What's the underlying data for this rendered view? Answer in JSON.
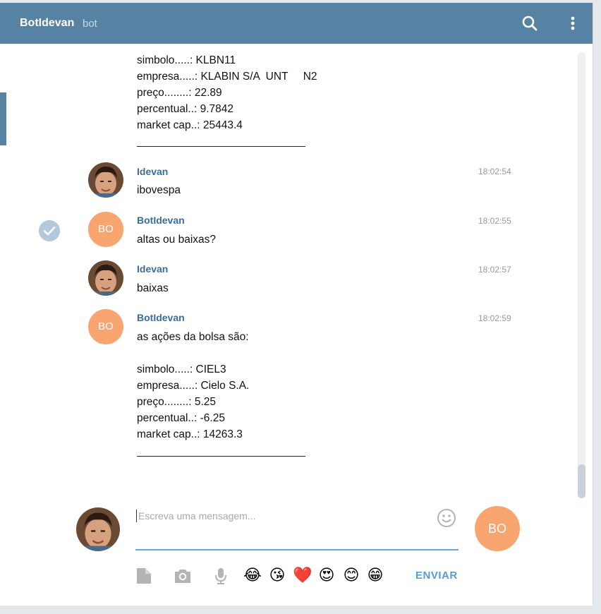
{
  "header": {
    "title": "BotIdevan",
    "subtitle": "bot",
    "search_icon": "search-icon",
    "menu_icon": "more-vert-icon",
    "bg_color": "#5682a3"
  },
  "messages": {
    "top_continuation": {
      "lines": [
        "simbolo.....: KLBN11",
        "empresa.....: KLABIN S/A  UNT     N2",
        "preço........: 22.89",
        "percentual..: 9.7842",
        "market cap..: 25443.4"
      ]
    },
    "m1": {
      "author": "Idevan",
      "time": "18:02:54",
      "text": "ibovespa"
    },
    "m2": {
      "author": "BotIdevan",
      "time": "18:02:55",
      "text": "altas ou baixas?",
      "avatar_initials": "BO",
      "status_icon": "check-circle-icon"
    },
    "m3": {
      "author": "Idevan",
      "time": "18:02:57",
      "text": "baixas"
    },
    "m4": {
      "author": "BotIdevan",
      "time": "18:02:59",
      "avatar_initials": "BO",
      "lines": [
        "as ações da bolsa são:",
        "simbolo.....: CIEL3",
        "empresa.....: Cielo S.A.",
        "preço........: 5.25",
        "percentual..: -6.25",
        "market cap..: 14263.3"
      ]
    }
  },
  "compose": {
    "placeholder": "Escreva uma mensagem...",
    "avatar_initials": "BO",
    "send_label": "ENVIAR",
    "emojis": [
      "😂",
      "😘",
      "❤️",
      "😍",
      "😊",
      "😁"
    ],
    "tools": [
      "file-icon",
      "camera-icon",
      "microphone-icon"
    ]
  },
  "colors": {
    "accent": "#5682a3",
    "author": "#3a6d99",
    "bot_avatar": "#f8a56f",
    "send": "#5a9bd2"
  }
}
